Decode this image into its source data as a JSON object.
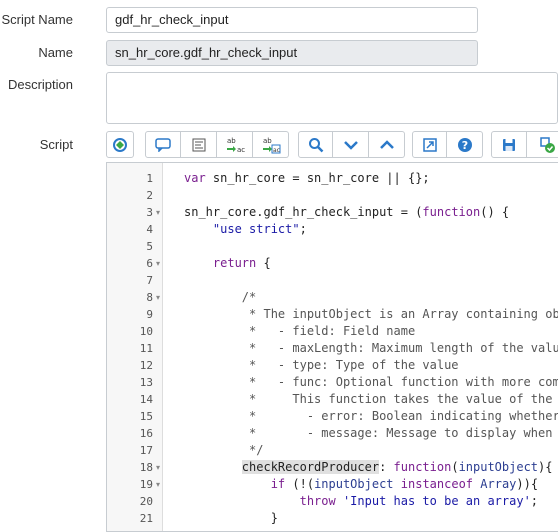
{
  "form": {
    "script_name_label": "Script Name",
    "script_name_value": "gdf_hr_check_input",
    "name_label": "Name",
    "name_value": "sn_hr_core.gdf_hr_check_input",
    "description_label": "Description",
    "description_value": "",
    "script_label": "Script"
  },
  "toolbar": {
    "buttons": [
      "script-debugger-icon",
      "comment-icon",
      "format-icon",
      "replace-icon",
      "replace-all-icon",
      "search-icon",
      "fold-down-icon",
      "fold-up-icon",
      "fullscreen-icon",
      "help-icon",
      "save-icon",
      "script-check-icon"
    ]
  },
  "editor": {
    "line_numbers": [
      "1",
      "2",
      "3",
      "4",
      "5",
      "6",
      "7",
      "8",
      "9",
      "10",
      "11",
      "12",
      "13",
      "14",
      "15",
      "16",
      "17",
      "18",
      "19",
      "20",
      "21"
    ],
    "lines": [
      "var sn_hr_core = sn_hr_core || {};",
      "",
      "sn_hr_core.gdf_hr_check_input = (function() {",
      "    \"use strict\";",
      "",
      "    return {",
      "",
      "        /*",
      "         * The inputObject is an Array containing ob",
      "         *   - field: Field name",
      "         *   - maxLength: Maximum length of the valu",
      "         *   - type: Type of the value",
      "         *   - func: Optional function with more com",
      "         *     This function takes the value of the",
      "         *       - error: Boolean indicating whether",
      "         *       - message: Message to display when",
      "         */",
      "        checkRecordProducer: function(inputObject){",
      "            if (!(inputObject instanceof Array)){",
      "                throw 'Input has to be an array';",
      "            }"
    ]
  }
}
